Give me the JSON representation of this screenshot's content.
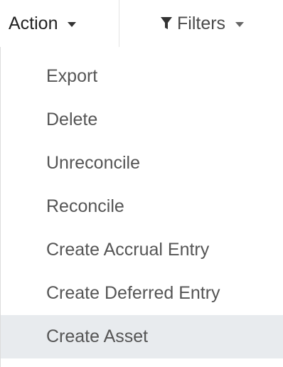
{
  "toolbar": {
    "action_label": "Action",
    "filters_label": "Filters"
  },
  "icons": {
    "action_caret": "caret-down",
    "filter": "funnel-filled",
    "filters_caret": "caret-down"
  },
  "menu": {
    "items": [
      {
        "label": "Export"
      },
      {
        "label": "Delete"
      },
      {
        "label": "Unreconcile"
      },
      {
        "label": "Reconcile"
      },
      {
        "label": "Create Accrual Entry"
      },
      {
        "label": "Create Deferred Entry"
      },
      {
        "label": "Create Asset"
      }
    ],
    "highlighted_index": 6
  },
  "colors": {
    "highlight_background": "#e8ebee",
    "menu_text": "#555555"
  }
}
